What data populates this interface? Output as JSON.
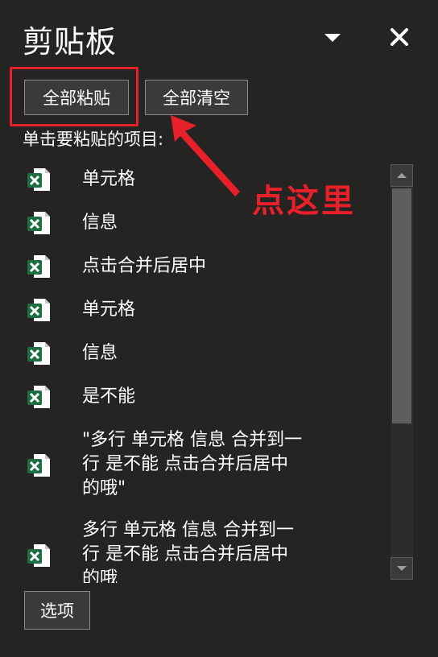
{
  "pane": {
    "title": "剪贴板",
    "paste_all_label": "全部粘贴",
    "clear_all_label": "全部清空",
    "instruction": "单击要粘贴的项目:",
    "options_label": "选项"
  },
  "annotation": {
    "text": "点这里",
    "color": "#e8202a"
  },
  "items": [
    {
      "label": "单元格",
      "icon": "excel-file-icon"
    },
    {
      "label": "信息",
      "icon": "excel-file-icon"
    },
    {
      "label": "点击合并后居中",
      "icon": "excel-file-icon"
    },
    {
      "label": "单元格",
      "icon": "excel-file-icon"
    },
    {
      "label": "信息",
      "icon": "excel-file-icon"
    },
    {
      "label": "是不能",
      "icon": "excel-file-icon"
    },
    {
      "label": "\"多行 单元格 信息 合并到一\n行 是不能 点击合并后居中\n的哦\"",
      "icon": "excel-file-icon"
    },
    {
      "label": "多行 单元格 信息 合并到一\n行 是不能 点击合并后居中\n的哦",
      "icon": "excel-file-icon"
    }
  ],
  "colors": {
    "background": "#252423",
    "excel_green": "#1d6f42",
    "highlight_red": "#e8202a"
  }
}
